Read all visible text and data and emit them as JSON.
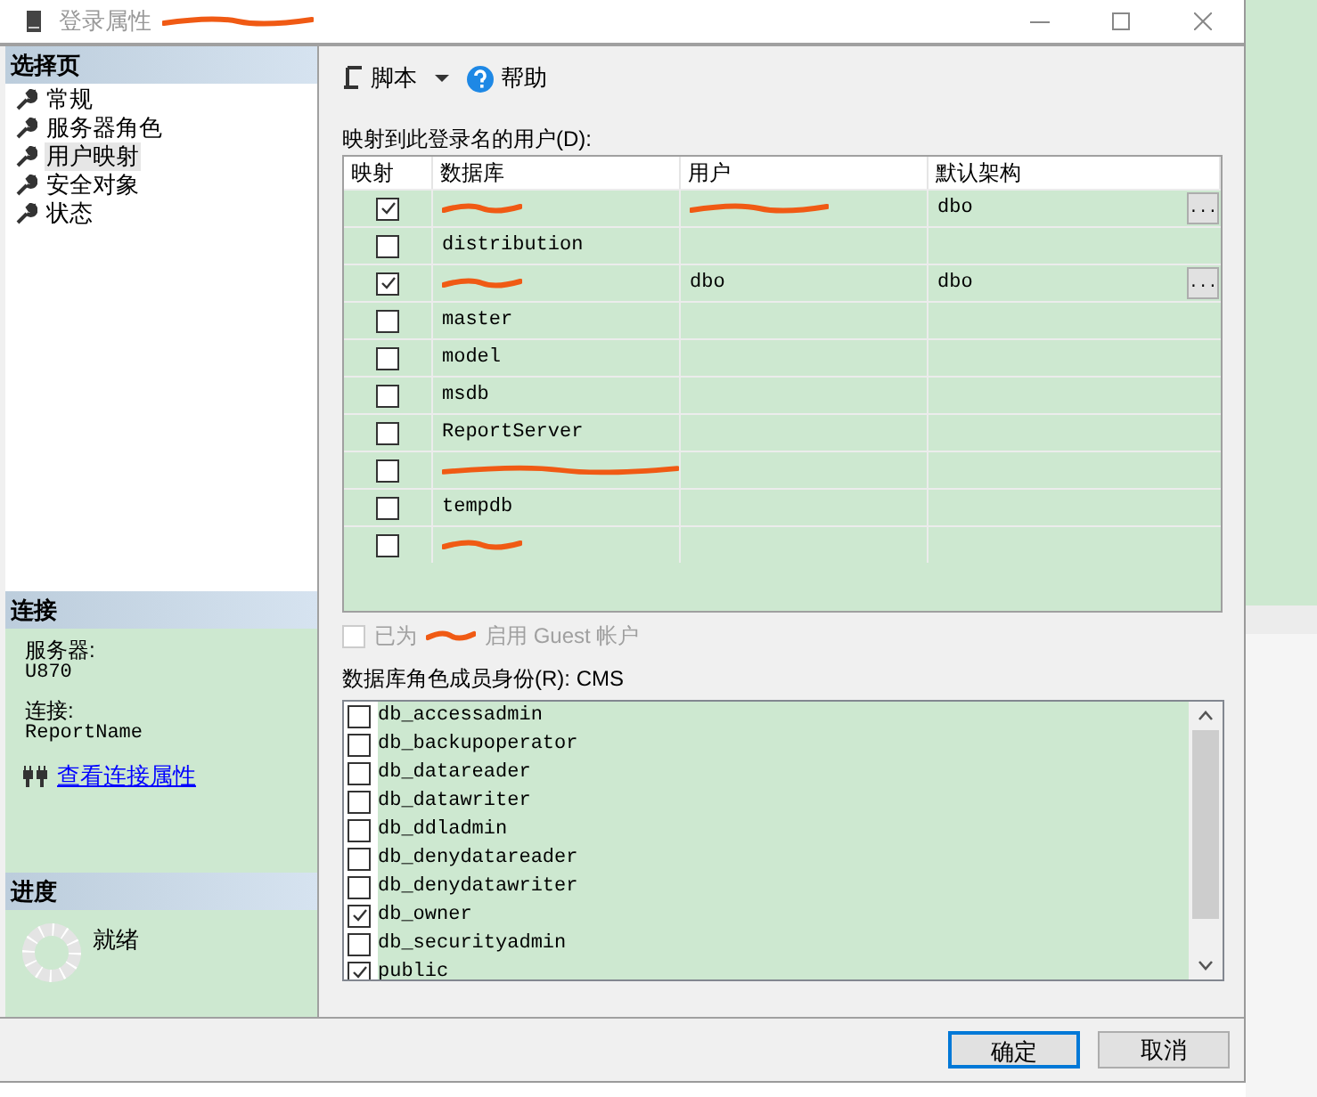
{
  "window": {
    "title": "登录属性",
    "title_redacted": true
  },
  "sidebar": {
    "header": "选择页",
    "items": [
      {
        "label": "常规",
        "selected": false
      },
      {
        "label": "服务器角色",
        "selected": false
      },
      {
        "label": "用户映射",
        "selected": true
      },
      {
        "label": "安全对象",
        "selected": false
      },
      {
        "label": "状态",
        "selected": false
      }
    ]
  },
  "connection": {
    "header": "连接",
    "server_label": "服务器:",
    "server": "U870",
    "connection_label": "连接:",
    "connection": "ReportName",
    "link": "查看连接属性"
  },
  "progress": {
    "header": "进度",
    "status": "就绪"
  },
  "toolbar": {
    "script": "脚本",
    "help": "帮助"
  },
  "mapping": {
    "label": "映射到此登录名的用户(D):",
    "columns": [
      "映射",
      "数据库",
      "用户",
      "默认架构"
    ],
    "rows": [
      {
        "checked": true,
        "database_redacted": true,
        "user_redacted": true,
        "schema": "dbo",
        "browse": "..."
      },
      {
        "checked": false,
        "database": "distribution"
      },
      {
        "checked": true,
        "database_redacted": true,
        "user": "dbo",
        "schema": "dbo",
        "browse": "..."
      },
      {
        "checked": false,
        "database": "master"
      },
      {
        "checked": false,
        "database": "model"
      },
      {
        "checked": false,
        "database": "msdb"
      },
      {
        "checked": false,
        "database": "ReportServer"
      },
      {
        "checked": false,
        "database_redacted": true
      },
      {
        "checked": false,
        "database": "tempdb"
      },
      {
        "checked": false,
        "database_redacted": true
      }
    ]
  },
  "guest": {
    "checked": false,
    "disabled": true,
    "text_before": "已为",
    "text_after": "启用 Guest 帐户"
  },
  "roles": {
    "label": "数据库角色成员身份(R): CMS",
    "items": [
      {
        "name": "db_accessadmin",
        "checked": false
      },
      {
        "name": "db_backupoperator",
        "checked": false
      },
      {
        "name": "db_datareader",
        "checked": false
      },
      {
        "name": "db_datawriter",
        "checked": false
      },
      {
        "name": "db_ddladmin",
        "checked": false
      },
      {
        "name": "db_denydatareader",
        "checked": false
      },
      {
        "name": "db_denydatawriter",
        "checked": false
      },
      {
        "name": "db_owner",
        "checked": true
      },
      {
        "name": "db_securityadmin",
        "checked": false
      },
      {
        "name": "public",
        "checked": true
      }
    ]
  },
  "buttons": [
    {
      "label": "确定",
      "default": true
    },
    {
      "label": "取消",
      "default": false
    }
  ]
}
